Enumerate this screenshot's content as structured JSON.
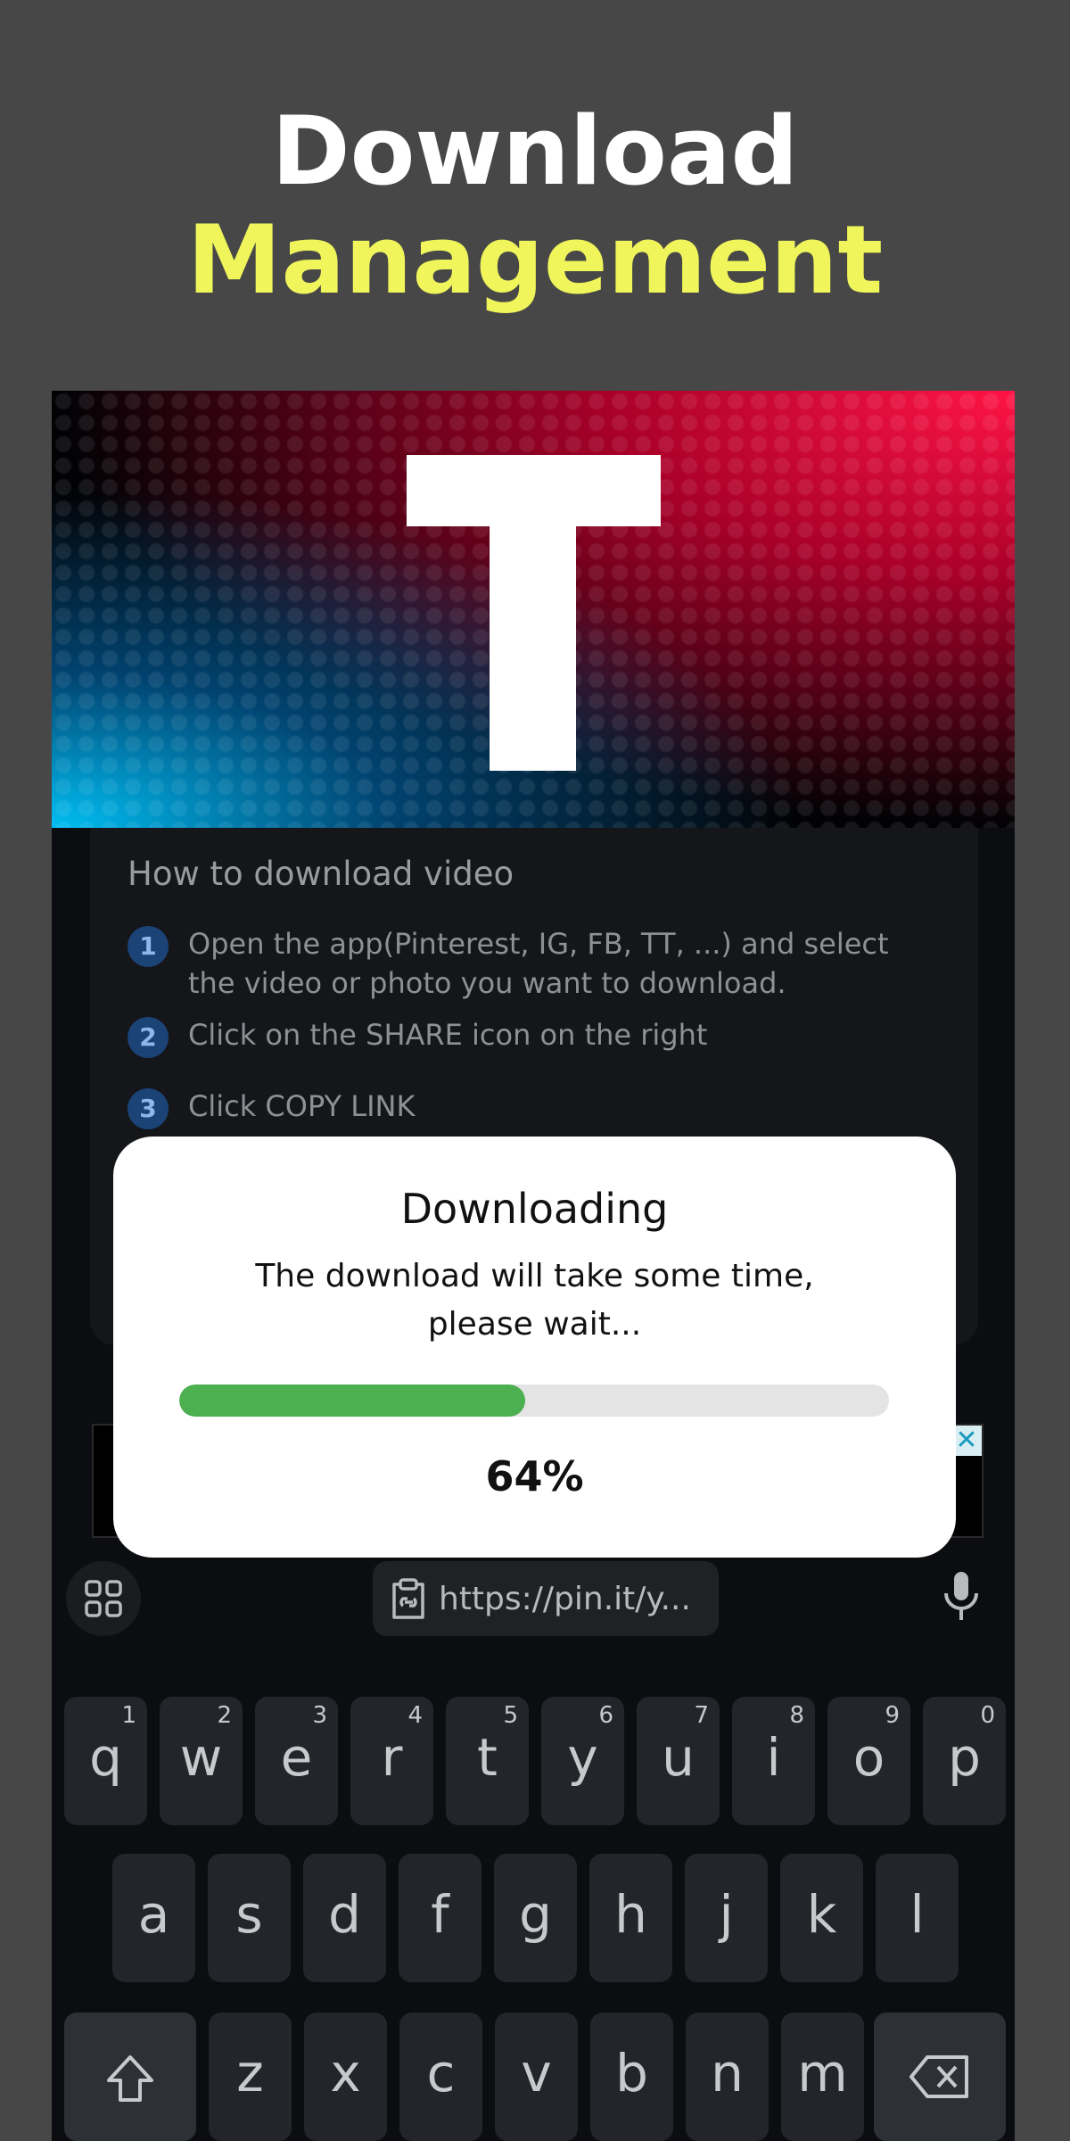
{
  "headline": {
    "line1": "Download",
    "line2": "Management"
  },
  "banner": {
    "logo_icon": "tiktok-t-logo"
  },
  "howto": {
    "title": "How to download video",
    "steps": [
      {
        "num": "1",
        "text": "Open the app(Pinterest, IG, FB, TT, ...) and select the video or photo you want to download."
      },
      {
        "num": "2",
        "text": "Click on the SHARE icon on the right"
      },
      {
        "num": "3",
        "text": "Click COPY LINK"
      }
    ]
  },
  "ad": {
    "close_label": "✕"
  },
  "keyboard_toolbar": {
    "grid_icon": "apps-grid-icon",
    "clipboard_text": "https://pin.it/y...",
    "mic_icon": "microphone-icon"
  },
  "keyboard": {
    "row1": [
      {
        "k": "q",
        "n": "1"
      },
      {
        "k": "w",
        "n": "2"
      },
      {
        "k": "e",
        "n": "3"
      },
      {
        "k": "r",
        "n": "4"
      },
      {
        "k": "t",
        "n": "5"
      },
      {
        "k": "y",
        "n": "6"
      },
      {
        "k": "u",
        "n": "7"
      },
      {
        "k": "i",
        "n": "8"
      },
      {
        "k": "o",
        "n": "9"
      },
      {
        "k": "p",
        "n": "0"
      }
    ],
    "row2": [
      "a",
      "s",
      "d",
      "f",
      "g",
      "h",
      "j",
      "k",
      "l"
    ],
    "row3": [
      "z",
      "x",
      "c",
      "v",
      "b",
      "n",
      "m"
    ]
  },
  "modal": {
    "title": "Downloading",
    "message": "The download will take some time, please wait...",
    "progress_fraction": 0.487,
    "percent_label": "64%"
  },
  "colors": {
    "accent_yellow": "#eff55a",
    "progress_green": "#4caf50",
    "step_badge": "#1b4376"
  }
}
